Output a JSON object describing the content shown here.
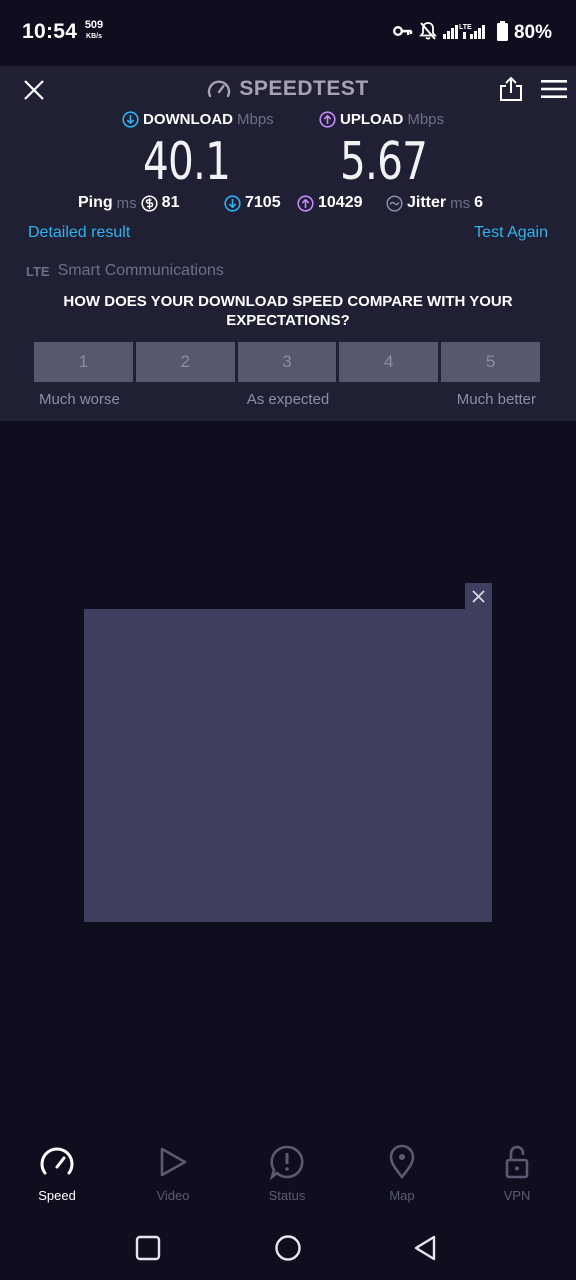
{
  "status_bar": {
    "time": "10:54",
    "net_speed_value": "509",
    "net_speed_unit": "KB/s",
    "network_type": "LTE",
    "battery": "80%"
  },
  "header": {
    "title": "SPEEDTEST"
  },
  "results": {
    "download_label": "DOWNLOAD",
    "download_unit": "Mbps",
    "download_value": "40.1",
    "upload_label": "UPLOAD",
    "upload_unit": "Mbps",
    "upload_value": "5.67",
    "ping_label": "Ping",
    "ping_unit": "ms",
    "ping_value": "81",
    "download_ping_value": "7105",
    "upload_ping_value": "10429",
    "jitter_label": "Jitter",
    "jitter_unit": "ms",
    "jitter_value": "6"
  },
  "actions": {
    "detailed_result": "Detailed result",
    "test_again": "Test Again"
  },
  "carrier": {
    "tech": "LTE",
    "name": "Smart Communications"
  },
  "survey": {
    "question": "HOW DOES YOUR DOWNLOAD SPEED COMPARE WITH YOUR EXPECTATIONS?",
    "options": [
      "1",
      "2",
      "3",
      "4",
      "5"
    ],
    "label_low": "Much worse",
    "label_mid": "As expected",
    "label_high": "Much better"
  },
  "bottom_nav": {
    "speed": "Speed",
    "video": "Video",
    "status": "Status",
    "map": "Map",
    "vpn": "VPN"
  },
  "colors": {
    "accent_blue": "#2db3ef",
    "upload_purple": "#c58af9",
    "panel_bg": "#1f2033",
    "screen_bg": "#0f0e1f"
  }
}
